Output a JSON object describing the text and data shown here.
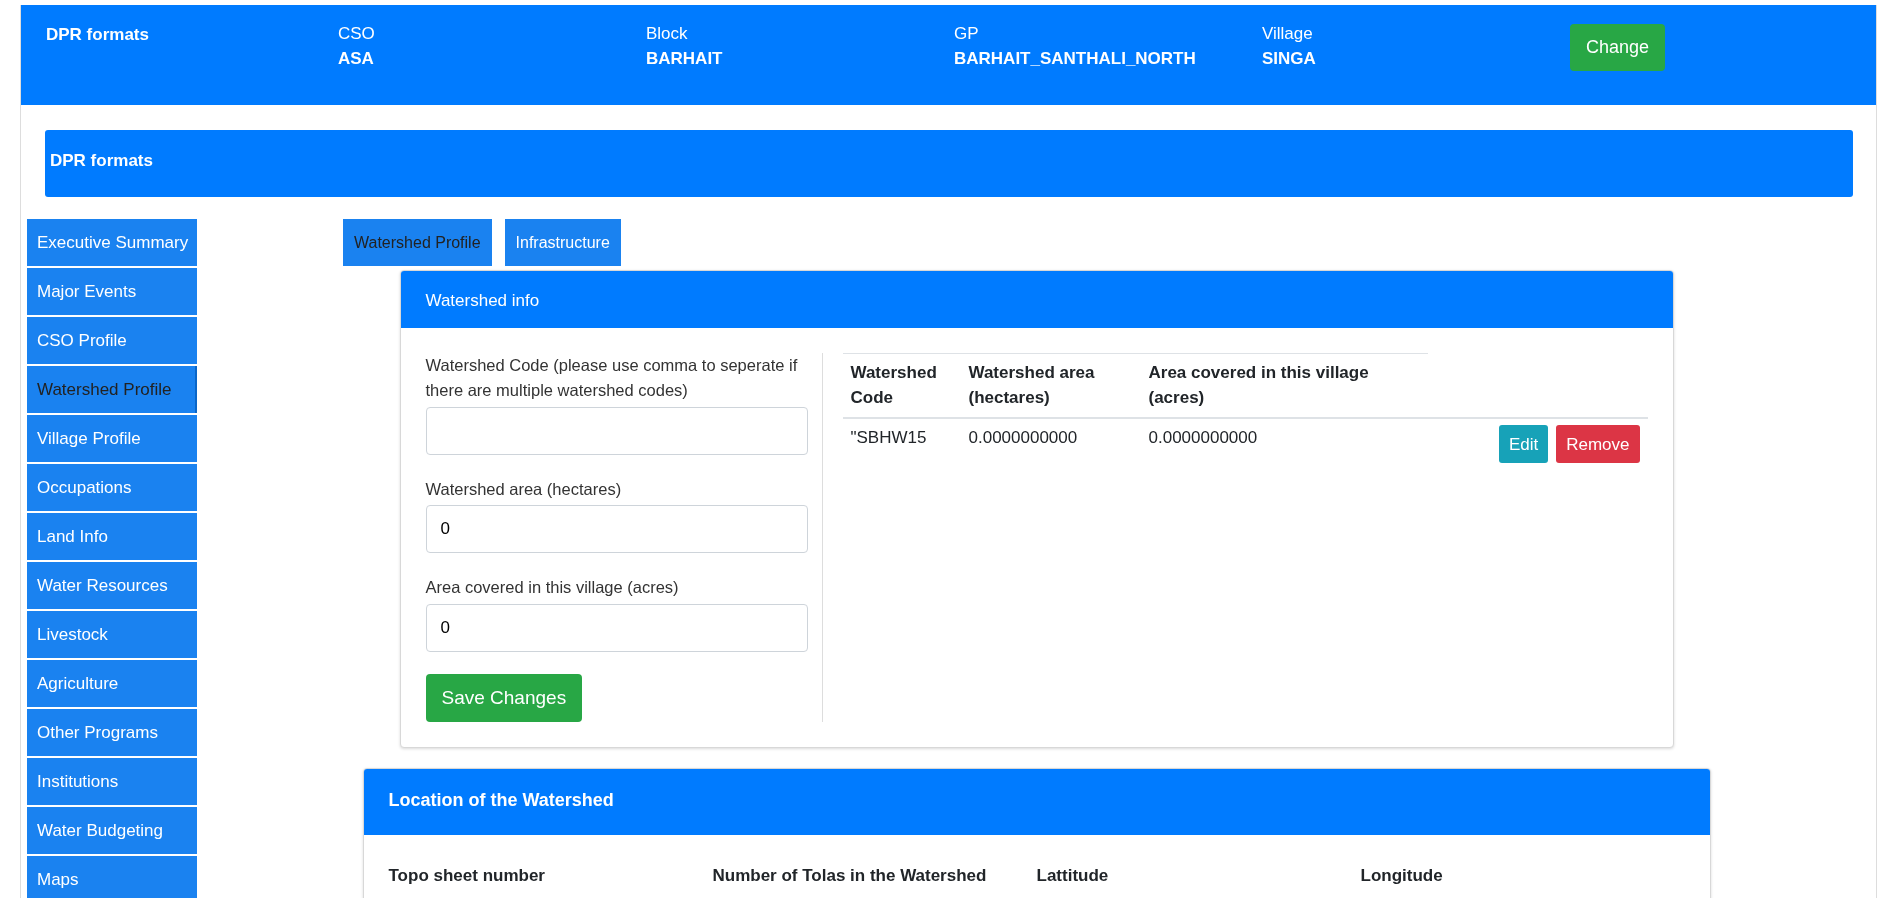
{
  "header": {
    "title": "DPR formats",
    "fields": [
      {
        "label": "CSO",
        "value": "ASA"
      },
      {
        "label": "Block",
        "value": "BARHAIT"
      },
      {
        "label": "GP",
        "value": "BARHAIT_SANTHALI_NORTH"
      },
      {
        "label": "Village",
        "value": "SINGA"
      }
    ],
    "button": "Change"
  },
  "panel_title": "DPR formats",
  "sidebar": {
    "items": [
      {
        "label": "Executive Summary",
        "selected": false
      },
      {
        "label": "Major Events",
        "selected": false
      },
      {
        "label": "CSO Profile",
        "selected": false
      },
      {
        "label": "Watershed Profile",
        "selected": true
      },
      {
        "label": "Village Profile",
        "selected": false
      },
      {
        "label": "Occupations",
        "selected": false
      },
      {
        "label": "Land Info",
        "selected": false
      },
      {
        "label": "Water Resources",
        "selected": false
      },
      {
        "label": "Livestock",
        "selected": false
      },
      {
        "label": "Agriculture",
        "selected": false
      },
      {
        "label": "Other Programs",
        "selected": false
      },
      {
        "label": "Institutions",
        "selected": false
      },
      {
        "label": "Water Budgeting",
        "selected": false
      },
      {
        "label": "Maps",
        "selected": false
      }
    ]
  },
  "tabs": [
    {
      "label": "Watershed Profile",
      "selected": true
    },
    {
      "label": "Infrastructure",
      "selected": false
    }
  ],
  "watershed_info": {
    "title": "Watershed info",
    "fields": [
      {
        "label": "Watershed Code (please use comma to seperate if there are multiple watershed codes)"
      },
      {
        "label": "Watershed area (hectares)",
        "value": "0"
      },
      {
        "label": "Area covered in this village (acres)",
        "value": "0"
      }
    ],
    "save_button": "Save Changes",
    "table": {
      "columns": [
        "Watershed Code",
        "Watershed area (hectares)",
        "Area covered in this village (acres)"
      ],
      "rows": [
        {
          "cells": [
            "\"SBHW15",
            "0.0000000000",
            "0.0000000000"
          ],
          "actions": [
            {
              "label": "Edit",
              "kind": "edit"
            },
            {
              "label": "Remove",
              "kind": "remove"
            }
          ]
        }
      ]
    }
  },
  "location": {
    "title": "Location of the Watershed",
    "columns": [
      "Topo sheet number",
      "Number of Tolas in the Watershed",
      "Lattitude",
      "Longitude"
    ]
  }
}
